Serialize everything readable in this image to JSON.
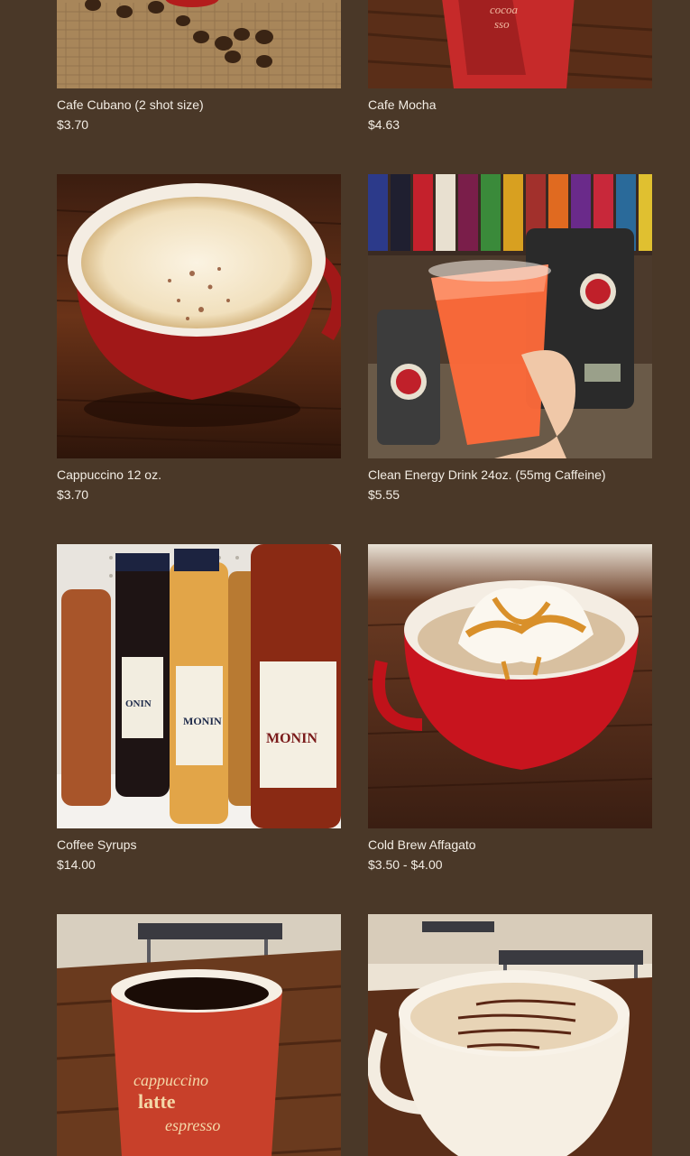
{
  "products": [
    {
      "name": "Cafe Cubano (2 shot size)",
      "price": "$3.70",
      "image": "coffee-beans-burlap"
    },
    {
      "name": "Cafe Mocha",
      "price": "$4.63",
      "image": "red-paper-cup"
    },
    {
      "name": "Cappuccino 12 oz.",
      "price": "$3.70",
      "image": "cappuccino-red-mug"
    },
    {
      "name": "Clean Energy Drink 24oz. (55mg Caffeine)",
      "price": "$5.55",
      "image": "orange-iced-drink"
    },
    {
      "name": "Coffee Syrups",
      "price": "$14.00",
      "image": "monin-syrup-bottles"
    },
    {
      "name": "Cold Brew Affagato",
      "price": "$3.50 - $4.00",
      "image": "caramel-whipped-red-mug"
    },
    {
      "name": "",
      "price": "",
      "image": "black-coffee-paper-cup"
    },
    {
      "name": "",
      "price": "",
      "image": "latte-white-mug"
    }
  ]
}
